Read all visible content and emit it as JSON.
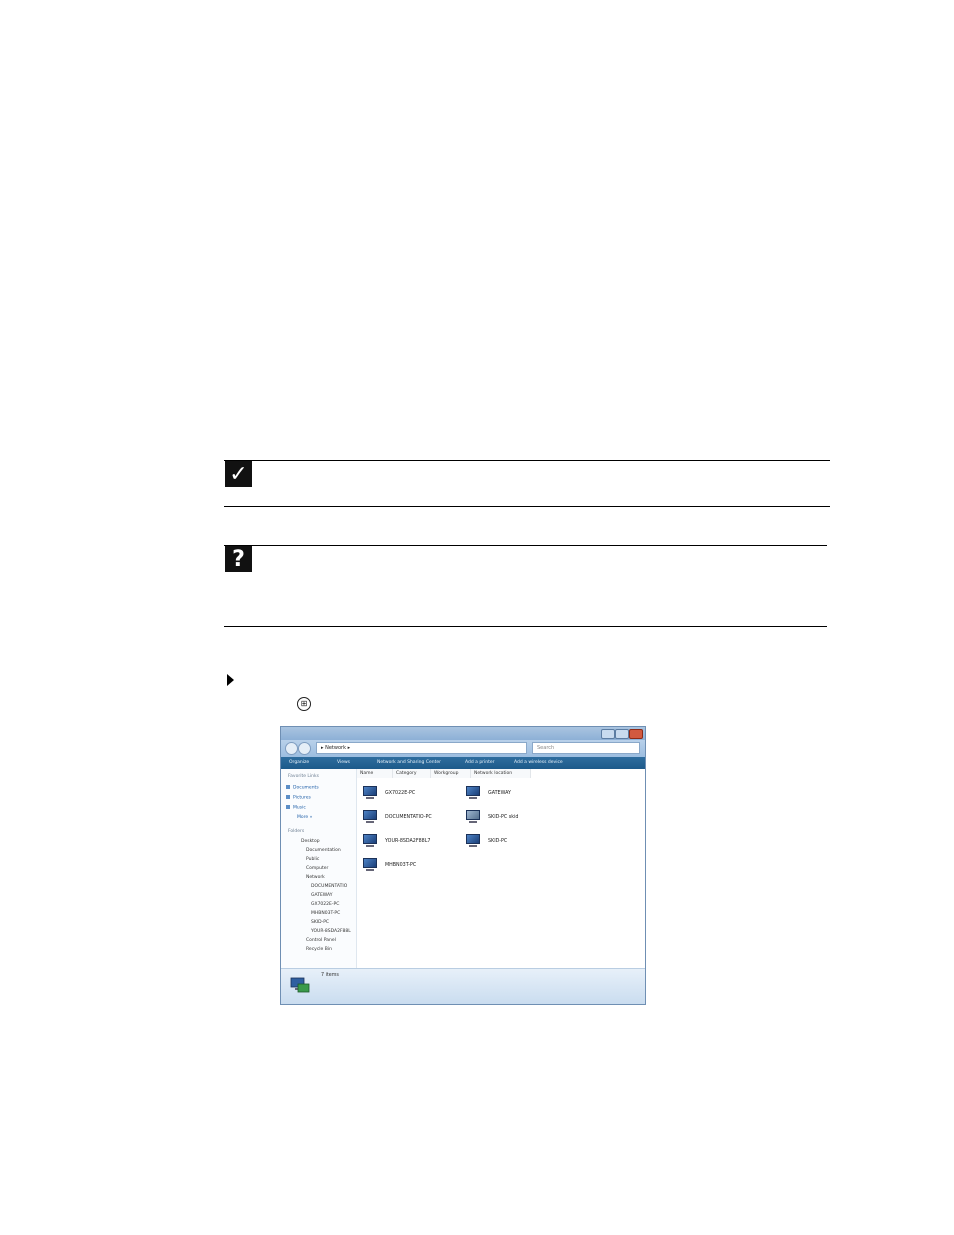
{
  "screenshot": {
    "address_path": "Network",
    "search_placeholder": "Search",
    "toolbar": {
      "organize": "Organize",
      "views": "Views",
      "network_center": "Network and Sharing Center",
      "add_printer": "Add a printer",
      "add_wireless": "Add a wireless device"
    },
    "favorite_links_label": "Favorite Links",
    "favorite_links": [
      "Documents",
      "Pictures",
      "Music",
      "More"
    ],
    "folders_label": "Folders",
    "tree": [
      "Desktop",
      "Documentation",
      "Public",
      "Computer",
      "Network",
      "DOCUMENTATIO",
      "GATEWAY",
      "GX7022E-PC",
      "MHBN03T-PC",
      "SKID-PC",
      "YOUR-8SDA2F88L",
      "Control Panel",
      "Recycle Bin"
    ],
    "columns": [
      "Name",
      "Category",
      "Workgroup",
      "Network location"
    ],
    "items": [
      "GX7022E-PC",
      "GATEWAY",
      "DOCUMENTATIO-PC",
      "SKID-PC skid",
      "YOUR-8SDA2F88L7",
      "SKID-PC",
      "MHBN03T-PC"
    ],
    "status": "7 items"
  }
}
